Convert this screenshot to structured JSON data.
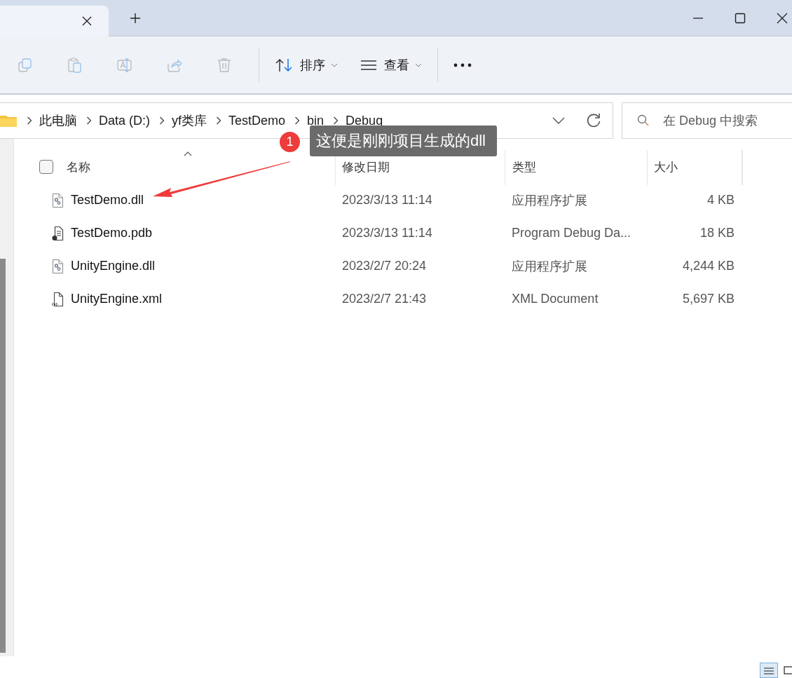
{
  "tab": {
    "selected": true
  },
  "toolbar": {
    "icon_buttons": [
      {
        "kind": "copy",
        "disabled": true
      },
      {
        "kind": "paste",
        "disabled": true
      },
      {
        "kind": "rename",
        "disabled": true
      },
      {
        "kind": "share",
        "disabled": true
      },
      {
        "kind": "delete",
        "disabled": true
      }
    ],
    "sort_label": "排序",
    "view_label": "查看"
  },
  "breadcrumb": [
    "此电脑",
    "Data (D:)",
    "yf类库",
    "TestDemo",
    "bin",
    "Debug"
  ],
  "search": {
    "placeholder": "在 Debug 中搜索"
  },
  "select_all": {
    "checked": false
  },
  "columns": [
    "名称",
    "修改日期",
    "类型",
    "大小"
  ],
  "rows": [
    {
      "kind": "dll",
      "name": "TestDemo.dll",
      "date": "2023/3/13 11:14",
      "type": "应用程序扩展",
      "size": "4 KB"
    },
    {
      "kind": "pdb",
      "name": "TestDemo.pdb",
      "date": "2023/3/13 11:14",
      "type": "Program Debug Da...",
      "size": "18 KB"
    },
    {
      "kind": "dll",
      "name": "UnityEngine.dll",
      "date": "2023/2/7 20:24",
      "type": "应用程序扩展",
      "size": "4,244 KB"
    },
    {
      "kind": "xml",
      "name": "UnityEngine.xml",
      "date": "2023/2/7 21:43",
      "type": "XML Document",
      "size": "5,697 KB"
    }
  ],
  "annotation": {
    "number": "1",
    "text": "这便是刚刚项目生成的dll"
  },
  "view_toggle": [
    {
      "kind": "details",
      "selected": true
    },
    {
      "kind": "tiles",
      "selected": false
    }
  ]
}
